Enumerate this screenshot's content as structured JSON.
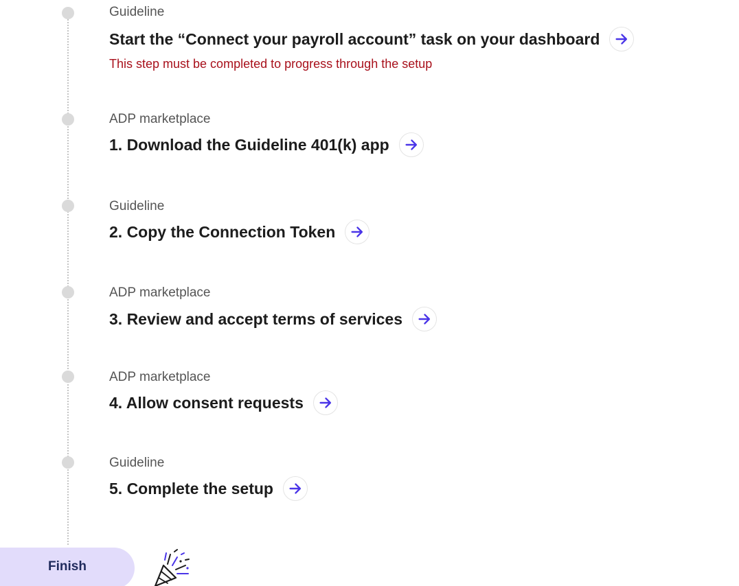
{
  "steps": [
    {
      "source": "Guideline",
      "title": "Start the “Connect your payroll account” task on your dashboard",
      "note": "This step must be completed to progress through the setup",
      "action_icon": "arrow-right-icon"
    },
    {
      "source": "ADP marketplace",
      "title": "1. Download the Guideline 401(k) app",
      "action_icon": "arrow-right-icon"
    },
    {
      "source": "Guideline",
      "title": "2. Copy the Connection Token",
      "action_icon": "arrow-right-icon"
    },
    {
      "source": "ADP marketplace",
      "title": "3. Review and accept terms of services",
      "action_icon": "arrow-right-icon"
    },
    {
      "source": "ADP marketplace",
      "title": "4. Allow consent requests",
      "action_icon": "arrow-right-icon"
    },
    {
      "source": "Guideline",
      "title": "5. Complete the setup",
      "action_icon": "arrow-right-icon"
    }
  ],
  "finish": {
    "label": "Finish",
    "icon": "party-popper-icon"
  },
  "colors": {
    "accent": "#4a35e8",
    "warning_text": "#a8101b",
    "finish_bg": "#e2dcfb",
    "timeline_dot": "#dadada"
  }
}
